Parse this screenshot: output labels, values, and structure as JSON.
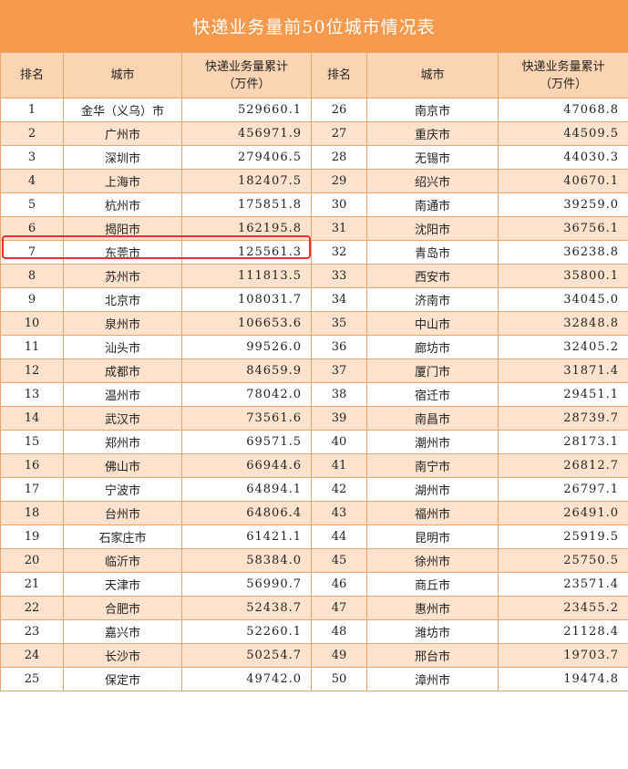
{
  "title": "快递业务量前50位城市情况表",
  "headers": {
    "rank": "排名",
    "city": "城市",
    "volume_line1": "快递业务量累计",
    "volume_line2": "（万件）"
  },
  "rows_left": [
    {
      "rank": "1",
      "city": "金华（义乌）市",
      "volume": "529660.1"
    },
    {
      "rank": "2",
      "city": "广州市",
      "volume": "456971.9"
    },
    {
      "rank": "3",
      "city": "深圳市",
      "volume": "279406.5"
    },
    {
      "rank": "4",
      "city": "上海市",
      "volume": "182407.5"
    },
    {
      "rank": "5",
      "city": "杭州市",
      "volume": "175851.8"
    },
    {
      "rank": "6",
      "city": "揭阳市",
      "volume": "162195.8"
    },
    {
      "rank": "7",
      "city": "东莞市",
      "volume": "125561.3"
    },
    {
      "rank": "8",
      "city": "苏州市",
      "volume": "111813.5"
    },
    {
      "rank": "9",
      "city": "北京市",
      "volume": "108031.7"
    },
    {
      "rank": "10",
      "city": "泉州市",
      "volume": "106653.6"
    },
    {
      "rank": "11",
      "city": "汕头市",
      "volume": "99526.0"
    },
    {
      "rank": "12",
      "city": "成都市",
      "volume": "84659.9"
    },
    {
      "rank": "13",
      "city": "温州市",
      "volume": "78042.0"
    },
    {
      "rank": "14",
      "city": "武汉市",
      "volume": "73561.6"
    },
    {
      "rank": "15",
      "city": "郑州市",
      "volume": "69571.5"
    },
    {
      "rank": "16",
      "city": "佛山市",
      "volume": "66944.6"
    },
    {
      "rank": "17",
      "city": "宁波市",
      "volume": "64894.1"
    },
    {
      "rank": "18",
      "city": "台州市",
      "volume": "64806.4"
    },
    {
      "rank": "19",
      "city": "石家庄市",
      "volume": "61421.1"
    },
    {
      "rank": "20",
      "city": "临沂市",
      "volume": "58384.0"
    },
    {
      "rank": "21",
      "city": "天津市",
      "volume": "56990.7"
    },
    {
      "rank": "22",
      "city": "合肥市",
      "volume": "52438.7"
    },
    {
      "rank": "23",
      "city": "嘉兴市",
      "volume": "52260.1"
    },
    {
      "rank": "24",
      "city": "长沙市",
      "volume": "50254.7"
    },
    {
      "rank": "25",
      "city": "保定市",
      "volume": "49742.0"
    }
  ],
  "rows_right": [
    {
      "rank": "26",
      "city": "南京市",
      "volume": "47068.8"
    },
    {
      "rank": "27",
      "city": "重庆市",
      "volume": "44509.5"
    },
    {
      "rank": "28",
      "city": "无锡市",
      "volume": "44030.3"
    },
    {
      "rank": "29",
      "city": "绍兴市",
      "volume": "40670.1"
    },
    {
      "rank": "30",
      "city": "南通市",
      "volume": "39259.0"
    },
    {
      "rank": "31",
      "city": "沈阳市",
      "volume": "36756.1"
    },
    {
      "rank": "32",
      "city": "青岛市",
      "volume": "36238.8"
    },
    {
      "rank": "33",
      "city": "西安市",
      "volume": "35800.1"
    },
    {
      "rank": "34",
      "city": "济南市",
      "volume": "34045.0"
    },
    {
      "rank": "35",
      "city": "中山市",
      "volume": "32848.8"
    },
    {
      "rank": "36",
      "city": "廊坊市",
      "volume": "32405.2"
    },
    {
      "rank": "37",
      "city": "厦门市",
      "volume": "31871.4"
    },
    {
      "rank": "38",
      "city": "宿迁市",
      "volume": "29451.1"
    },
    {
      "rank": "39",
      "city": "南昌市",
      "volume": "28739.7"
    },
    {
      "rank": "40",
      "city": "潮州市",
      "volume": "28173.1"
    },
    {
      "rank": "41",
      "city": "南宁市",
      "volume": "26812.7"
    },
    {
      "rank": "42",
      "city": "湖州市",
      "volume": "26797.1"
    },
    {
      "rank": "43",
      "city": "福州市",
      "volume": "26491.0"
    },
    {
      "rank": "44",
      "city": "昆明市",
      "volume": "25919.5"
    },
    {
      "rank": "45",
      "city": "徐州市",
      "volume": "25750.5"
    },
    {
      "rank": "46",
      "city": "商丘市",
      "volume": "23571.4"
    },
    {
      "rank": "47",
      "city": "惠州市",
      "volume": "23455.2"
    },
    {
      "rank": "48",
      "city": "潍坊市",
      "volume": "21128.4"
    },
    {
      "rank": "49",
      "city": "邢台市",
      "volume": "19703.7"
    },
    {
      "rank": "50",
      "city": "漳州市",
      "volume": "19474.8"
    }
  ],
  "highlighted_rank": "6",
  "colors": {
    "title_bg": "#f79a4d",
    "header_bg": "#fbd4b3",
    "stripe_bg": "#fde3cd",
    "border": "#e8a56e",
    "highlight_border": "#e5322d"
  }
}
